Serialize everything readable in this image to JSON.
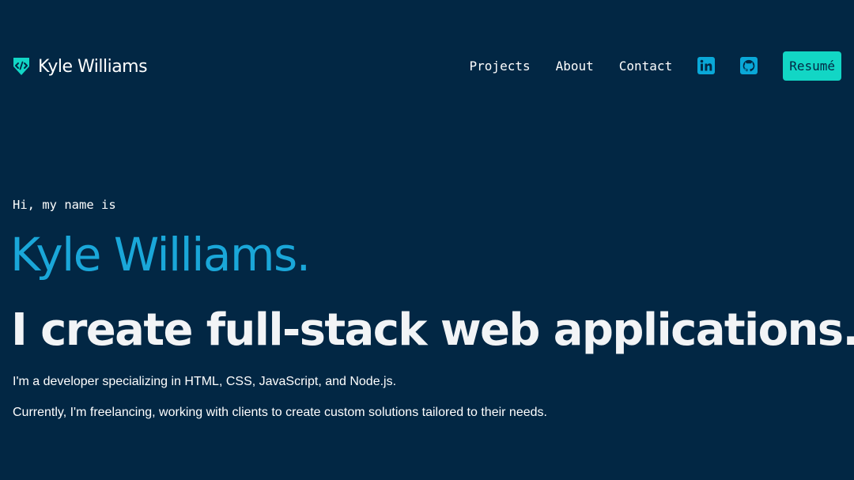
{
  "brand": {
    "name": "Kyle Williams",
    "icon": "code-shield-icon"
  },
  "nav": {
    "links": [
      "Projects",
      "About",
      "Contact"
    ],
    "social": [
      {
        "name": "linkedin-icon"
      },
      {
        "name": "github-icon"
      }
    ],
    "resume_label": "Resumé"
  },
  "hero": {
    "greeting": "Hi, my name is",
    "name": "Kyle Williams.",
    "tagline": "I create full-stack web applications.",
    "paragraphs": [
      "I'm a developer specializing in HTML, CSS, JavaScript, and Node.js.",
      "Currently, I'm freelancing, working with clients to create custom solutions tailored to their needs."
    ]
  },
  "colors": {
    "background": "#022744",
    "accent_teal": "#12d6c5",
    "accent_blue": "#1aa7d9",
    "icon_blue": "#0aa8d8",
    "text": "#ffffff"
  }
}
